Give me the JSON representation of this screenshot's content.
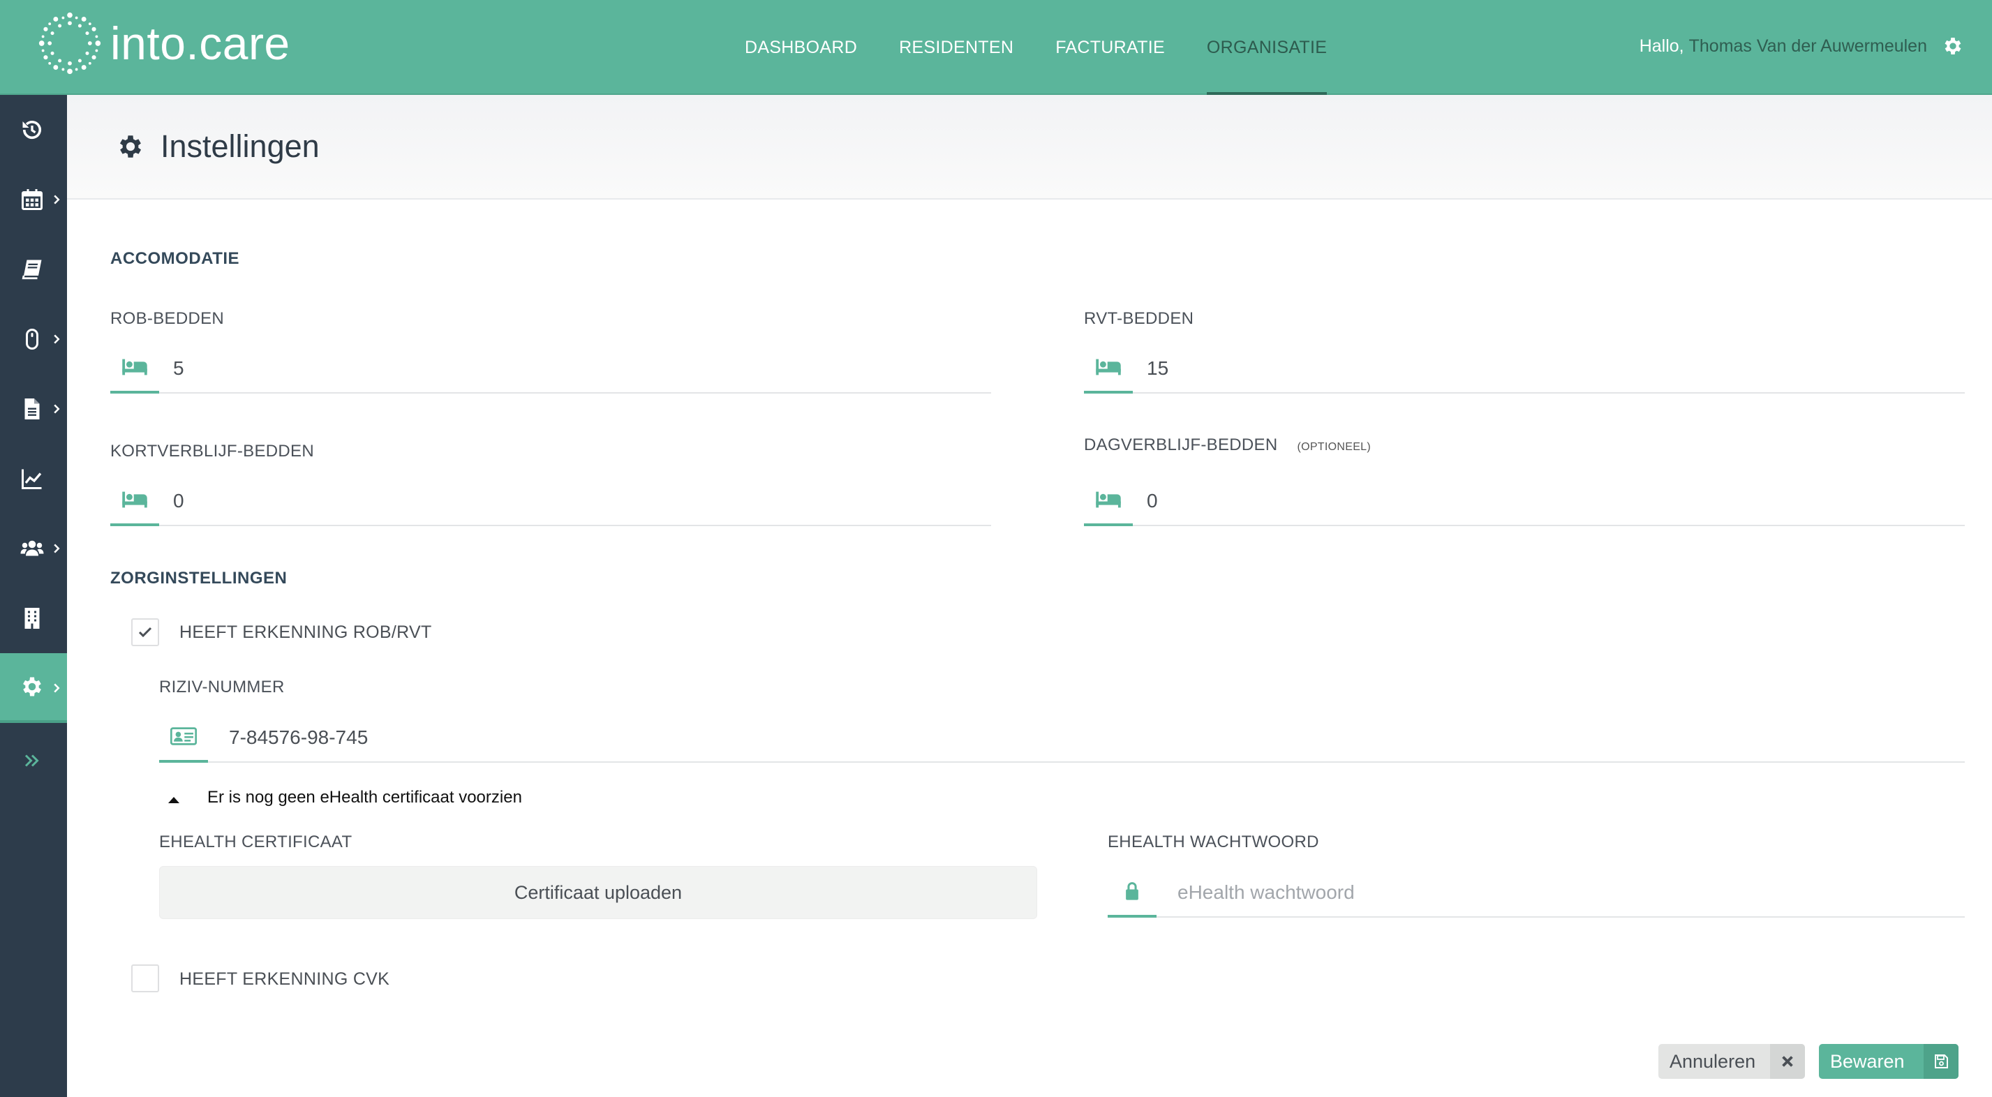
{
  "app": {
    "brand": "into.care",
    "colors": {
      "primary": "#5bb59b",
      "sidebar": "#2d3c4b",
      "text": "#4a4f55"
    }
  },
  "nav": {
    "items": [
      {
        "label": "DASHBOARD",
        "active": false
      },
      {
        "label": "RESIDENTEN",
        "active": false
      },
      {
        "label": "FACTURATIE",
        "active": false
      },
      {
        "label": "ORGANISATIE",
        "active": true
      }
    ]
  },
  "user": {
    "greeting": "Hallo,",
    "name": "Thomas Van der Auwermeulen"
  },
  "sidebar": {
    "items": [
      {
        "icon": "history-icon",
        "has_submenu": false
      },
      {
        "icon": "calendar-icon",
        "has_submenu": true
      },
      {
        "icon": "book-icon",
        "has_submenu": false
      },
      {
        "icon": "mouse-icon",
        "has_submenu": true
      },
      {
        "icon": "document-icon",
        "has_submenu": true
      },
      {
        "icon": "line-chart-icon",
        "has_submenu": false
      },
      {
        "icon": "users-icon",
        "has_submenu": true
      },
      {
        "icon": "building-icon",
        "has_submenu": false
      },
      {
        "icon": "gear-icon",
        "has_submenu": true,
        "active": true
      }
    ],
    "expand_icon": "double-chevron-right-icon"
  },
  "page": {
    "title": "Instellingen",
    "icon": "gear-icon"
  },
  "accomodatie": {
    "title": "ACCOMODATIE",
    "rob": {
      "label": "ROB-BEDDEN",
      "value": "5",
      "icon": "bed-icon"
    },
    "rvt": {
      "label": "RVT-BEDDEN",
      "value": "15",
      "icon": "bed-icon"
    },
    "kortverblijf": {
      "label": "KORTVERBLIJF-BEDDEN",
      "value": "0",
      "icon": "bed-icon"
    },
    "dagverblijf": {
      "label": "DAGVERBLIJF-BEDDEN",
      "optional": "(OPTIONEEL)",
      "value": "0",
      "icon": "bed-icon"
    }
  },
  "zorg": {
    "title": "ZORGINSTELLINGEN",
    "erkenning_rob_rvt": {
      "label": "HEEFT ERKENNING ROB/RVT",
      "checked": true
    },
    "riziv": {
      "label": "RIZIV-NUMMER",
      "value": "7-84576-98-745",
      "icon": "id-card-icon"
    },
    "ehealth_notice": "Er is nog geen eHealth certificaat voorzien",
    "certificaat": {
      "label": "EHEALTH CERTIFICAAT",
      "button": "Certificaat uploaden"
    },
    "wachtwoord": {
      "label": "EHEALTH WACHTWOORD",
      "placeholder": "eHealth wachtwoord",
      "icon": "lock-icon"
    },
    "erkenning_cvk": {
      "label": "HEEFT ERKENNING CVK",
      "checked": false
    }
  },
  "actions": {
    "cancel": {
      "label": "Annuleren",
      "icon": "close-icon"
    },
    "save": {
      "label": "Bewaren",
      "icon": "save-icon"
    }
  }
}
